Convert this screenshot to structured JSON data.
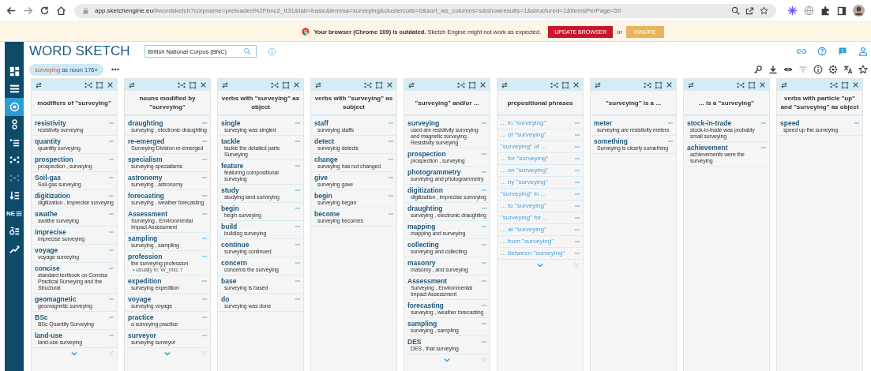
{
  "browser": {
    "url_host": "app.sketchengine.eu",
    "url_rest": "/#wordsketch?corpname=preloaded%2Fbnc2_tt31&tab=basic&lemma=surveying&clustercolls=0&sort_ws_columns=s&showresults=1&structured=1&itemsPerPage=50"
  },
  "banner": {
    "message": "**Your browser (Chrome 109) is outdated.** Sketch Engine might not work as expected.",
    "update_button": "UPDATE BROWSER",
    "separator": "or",
    "ignore_button": "IGNORE"
  },
  "sidebar": {
    "items": [
      {
        "kind": "grid",
        "selected": false,
        "disabled": false
      },
      {
        "kind": "menu",
        "selected": false,
        "disabled": false
      },
      {
        "kind": "target",
        "selected": true,
        "disabled": false
      },
      {
        "kind": "chain",
        "selected": false,
        "disabled": false
      },
      {
        "kind": "bullets",
        "selected": false,
        "disabled": false
      },
      {
        "kind": "scatter",
        "selected": false,
        "disabled": false
      },
      {
        "kind": "scatter",
        "selected": false,
        "disabled": true
      },
      {
        "kind": "sort",
        "selected": false,
        "disabled": false
      },
      {
        "kind": "letters",
        "label": "NE",
        "selected": false,
        "disabled": false
      },
      {
        "kind": "delta",
        "selected": false,
        "disabled": false
      },
      {
        "kind": "trend",
        "selected": false,
        "disabled": false
      }
    ]
  },
  "header": {
    "title": "WORD SKETCH",
    "corpus": "British National Corpus (BNC)",
    "lemma": "surveying",
    "lemma_info": "as noun 176×"
  },
  "columns": [
    {
      "title": "modifiers of \"surveying\"",
      "kind": "collocations",
      "has_more": true,
      "items": [
        {
          "word": "resistivity",
          "example": "resistivity surveying"
        },
        {
          "word": "quantity",
          "example": "quantity surveying"
        },
        {
          "word": "prospection",
          "example": "prospection , surveying"
        },
        {
          "word": "Soil-gas",
          "example": "Soil-gas surveying"
        },
        {
          "word": "digitization",
          "example": "digitization , imprecise surveying"
        },
        {
          "word": "swathe",
          "example": "swathe surveying"
        },
        {
          "word": "imprecise",
          "example": "imprecise surveying"
        },
        {
          "word": "voyage",
          "example": "voyage surveying"
        },
        {
          "word": "concise",
          "example": "standard textbook on Concise Practical Surveying and the Structural"
        },
        {
          "word": "geomagnetic",
          "example": "geomagnetic surveying"
        },
        {
          "word": "BSc",
          "example": "BSc Quantity Surveying"
        },
        {
          "word": "land-use",
          "example": "land-use surveying"
        }
      ]
    },
    {
      "title": "nouns modified by \"surveying\"",
      "kind": "collocations",
      "has_more": true,
      "items": [
        {
          "word": "draughting",
          "example": "surveying , electronic draughting"
        },
        {
          "word": "re-emerged",
          "example": "Surveying Division re-emerged"
        },
        {
          "word": "specialism",
          "example": "surveying specialisms"
        },
        {
          "word": "astronomy",
          "example": "surveying , astronomy"
        },
        {
          "word": "forecasting",
          "example": "surveying , weather forecasting"
        },
        {
          "word": "Assessment",
          "example": "Surveying , Environmental Impact Assessment"
        },
        {
          "word": "sampling",
          "example": "surveying , sampling"
        },
        {
          "word": "profession",
          "example": "the surveying profession",
          "note": "• usually in: W_msc ?"
        },
        {
          "word": "expedition",
          "example": "surveying expedition"
        },
        {
          "word": "voyage",
          "example": "surveying voyage"
        },
        {
          "word": "practice",
          "example": "a surveying practice"
        },
        {
          "word": "surveyor",
          "example": "surveying surveyor"
        }
      ]
    },
    {
      "title": "verbs with \"surveying\" as object",
      "kind": "collocations",
      "has_more": false,
      "items": [
        {
          "word": "single",
          "example": "surveying was singled"
        },
        {
          "word": "tackle",
          "example": "tackle the detailed parts Surveying"
        },
        {
          "word": "feature",
          "example": "featuring compositional surveying"
        },
        {
          "word": "study",
          "example": "studying land surveying"
        },
        {
          "word": "begin",
          "example": "begin surveying"
        },
        {
          "word": "build",
          "example": "building surveying"
        },
        {
          "word": "continue",
          "example": "surveying continued"
        },
        {
          "word": "concern",
          "example": "concerns the surveying"
        },
        {
          "word": "base",
          "example": "surveying is based"
        },
        {
          "word": "do",
          "example": "surveying was done"
        }
      ]
    },
    {
      "title": "verbs with \"surveying\" as subject",
      "kind": "collocations",
      "has_more": false,
      "items": [
        {
          "word": "staff",
          "example": "surveying staffs"
        },
        {
          "word": "detect",
          "example": "surveying detects"
        },
        {
          "word": "change",
          "example": "surveying has not changed"
        },
        {
          "word": "give",
          "example": "surveying gave"
        },
        {
          "word": "begin",
          "example": "surveying began"
        },
        {
          "word": "become",
          "example": "surveying becomes"
        }
      ]
    },
    {
      "title": "\"surveying\" and/or ...",
      "kind": "collocations",
      "has_more": true,
      "items": [
        {
          "word": "surveying",
          "example": "used are resistivity surveying and magnetic surveying . Resistivity surveying"
        },
        {
          "word": "prospection",
          "example": "prospection , surveying"
        },
        {
          "word": "photogrammetry",
          "example": "surveying and photogrammetry"
        },
        {
          "word": "digitization",
          "example": "digitization , imprecise surveying"
        },
        {
          "word": "draughting",
          "example": "surveying , electronic draughting"
        },
        {
          "word": "mapping",
          "example": "mapping and surveying"
        },
        {
          "word": "collecting",
          "example": "surveying and collecting"
        },
        {
          "word": "masonry",
          "example": "masonry , and surveying"
        },
        {
          "word": "Assessment",
          "example": "Surveying , Environmental Impact Assessment"
        },
        {
          "word": "forecasting",
          "example": "surveying , weather forecasting"
        },
        {
          "word": "sampling",
          "example": "surveying , sampling"
        },
        {
          "word": "DES",
          "example": "DES , that surveying"
        }
      ]
    },
    {
      "title": "prepositional phrases",
      "kind": "phrases",
      "has_more": true,
      "items": [
        {
          "word": "... in \"surveying\""
        },
        {
          "word": "... of \"surveying\""
        },
        {
          "word": "\"surveying\" of ..."
        },
        {
          "word": "... for \"surveying\""
        },
        {
          "word": "... on \"surveying\""
        },
        {
          "word": "... by \"surveying\""
        },
        {
          "word": "\"surveying\" in ..."
        },
        {
          "word": "... to \"surveying\""
        },
        {
          "word": "\"surveying\" for ..."
        },
        {
          "word": "... at \"surveying\""
        },
        {
          "word": "... from \"surveying\""
        },
        {
          "word": "... between \"surveying\""
        }
      ]
    },
    {
      "title": "\"surveying\" is a ...",
      "kind": "collocations",
      "has_more": false,
      "items": [
        {
          "word": "meter",
          "example": "surveying are resistivity meters"
        },
        {
          "word": "something",
          "example": "Surveying is clearly something"
        }
      ]
    },
    {
      "title": "... is a \"surveying\"",
      "kind": "collocations",
      "has_more": false,
      "items": [
        {
          "word": "stock-in-trade",
          "example": "stock-in-trade was probably small surveying"
        },
        {
          "word": "achievement",
          "example": "achievements were the surveying"
        }
      ]
    },
    {
      "title": "verbs with particle \"up\" and \"surveying\" as object",
      "kind": "collocations",
      "has_more": false,
      "items": [
        {
          "word": "speed",
          "example": "speed up the surveying"
        }
      ]
    }
  ]
}
